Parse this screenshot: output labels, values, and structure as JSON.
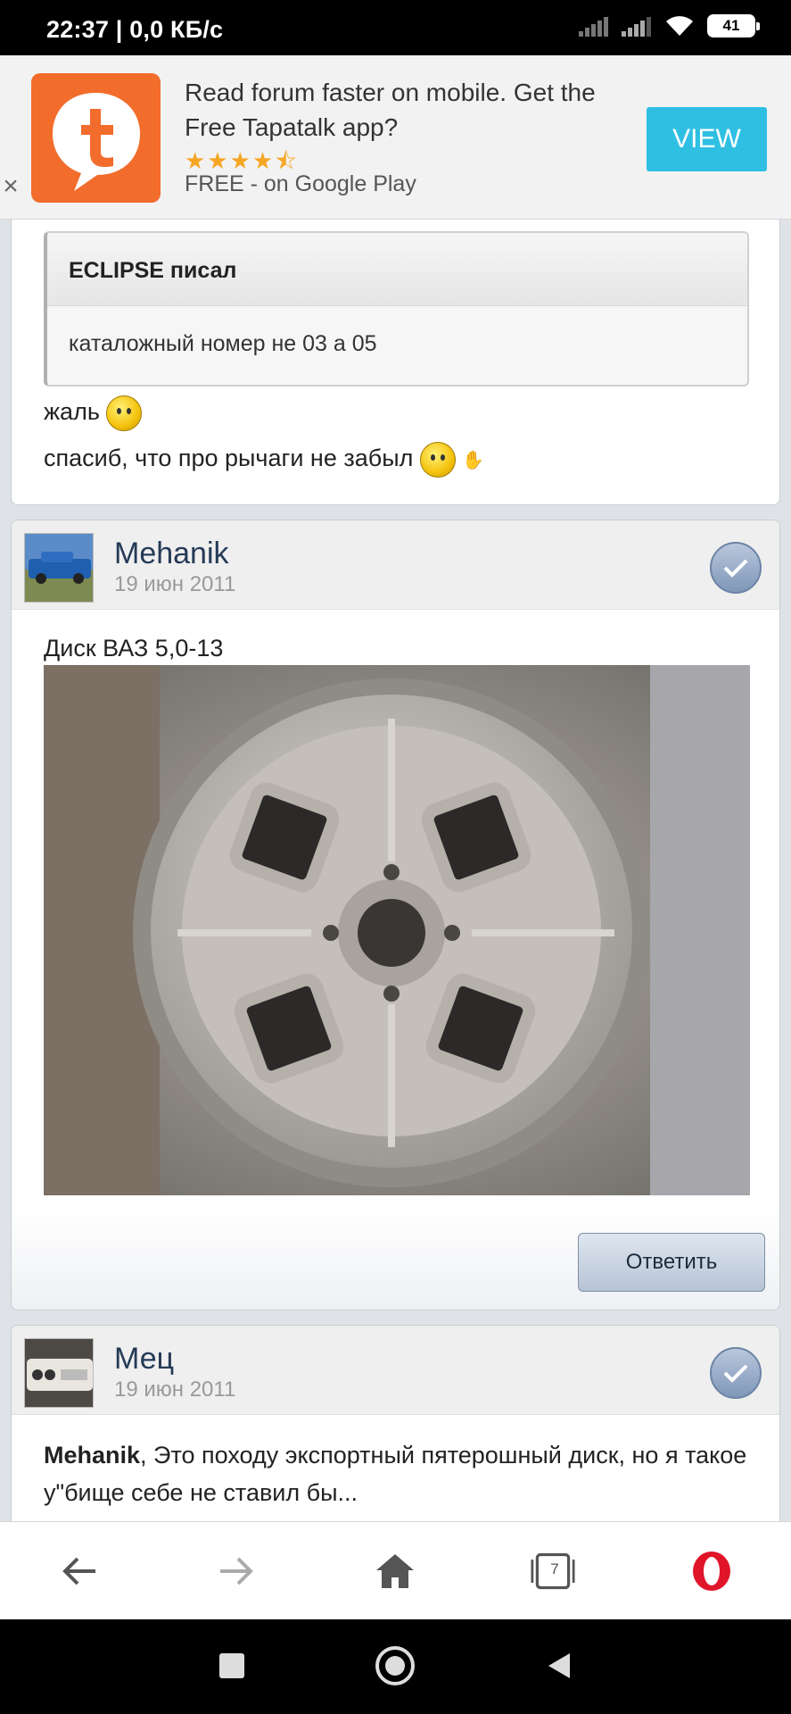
{
  "status_bar": {
    "time": "22:37 | 0,0 КБ/с",
    "battery": "41"
  },
  "banner": {
    "close": "×",
    "title": "Read forum faster on mobile. Get the Free Tapatalk app?",
    "rating": "★★★★⯪",
    "store": "FREE - on Google Play",
    "view": "VIEW"
  },
  "post1": {
    "quote_author": "ECLIPSE писал",
    "quote_text": "каталожный номер не 03 а 05",
    "line1": "жаль",
    "line2": "спасиб, что про рычаги не забыл"
  },
  "post2": {
    "username": "Mehanik",
    "date": "19 июн 2011",
    "text": "Диск ВАЗ 5,0-13",
    "reply": "Ответить"
  },
  "post3": {
    "username": "Мец",
    "date": "19 июн 2011",
    "mention": "Mehanik",
    "text": ", Это походу экспортный пятерошный диск, но я такое у\"бище себе не ставил бы..."
  },
  "bottom_nav": {
    "tabs_count": "7"
  },
  "colors": {
    "accent": "#2fbfe3",
    "tapatalk": "#f26c2c",
    "username": "#253a57",
    "opera_red": "#e0152a"
  }
}
